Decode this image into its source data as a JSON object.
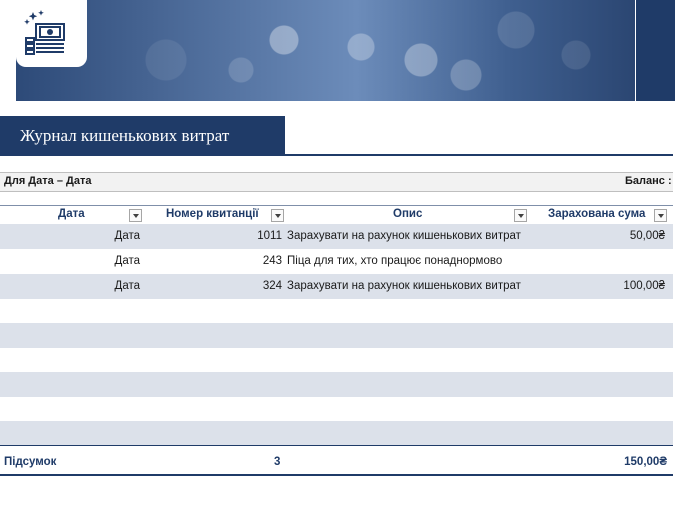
{
  "header": {
    "title": "Журнал кишенькових витрат",
    "date_range": "Для Дата – Дата",
    "balance_label": "Баланс :"
  },
  "table": {
    "columns": [
      "Дата",
      "Номер квитанції",
      "Опис",
      "Зарахована сума"
    ],
    "rows": [
      {
        "date": "Дата",
        "receipt": "1011",
        "description": "Зарахувати на рахунок кишенькових витрат",
        "amount": "50,00₴"
      },
      {
        "date": "Дата",
        "receipt": "243",
        "description": "Піца для тих, хто працює понаднормово",
        "amount": ""
      },
      {
        "date": "Дата",
        "receipt": "324",
        "description": "Зарахувати на рахунок кишенькових витрат",
        "amount": "100,00₴"
      }
    ],
    "empty_rows": 6
  },
  "totals": {
    "label": "Підсумок",
    "receipt_count": "3",
    "amount": "150,00₴"
  },
  "icons": {
    "logo": "money-stack-icon",
    "filter": "dropdown-arrow-icon"
  },
  "colors": {
    "accent": "#1f3b68",
    "band": "#dce1ea"
  }
}
